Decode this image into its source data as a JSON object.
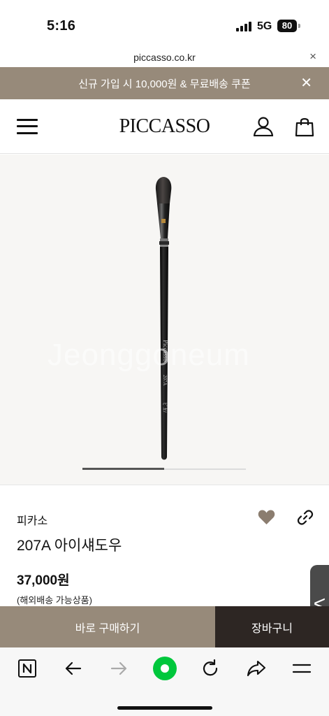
{
  "status": {
    "time": "5:16",
    "network": "5G",
    "battery": "80"
  },
  "browser": {
    "url": "piccasso.co.kr",
    "close": "×"
  },
  "promo": {
    "text": "신규 가입 시 10,000원 & 무료배송 쿠폰",
    "close": "✕"
  },
  "header": {
    "logo": "PICCASSO"
  },
  "gallery": {
    "watermark": "Jeonggoneum",
    "slide_index": 1,
    "slide_count": 2
  },
  "product": {
    "brand": "피카소",
    "name": "207A 아이섀도우",
    "price": "37,000원",
    "shipping": "(해외배송 가능상품)"
  },
  "actions": {
    "buy_label": "바로 구매하기",
    "cart_label": "장바구니"
  },
  "side_tab": {
    "label": "<"
  },
  "colors": {
    "accent": "#978a7a",
    "dark": "#2d2623",
    "navigator_green": "#00c73c"
  },
  "icons": [
    "hamburger-menu-icon",
    "user-icon",
    "shopping-bag-icon",
    "heart-icon",
    "link-icon",
    "naver-icon",
    "back-arrow-icon",
    "forward-arrow-icon",
    "green-dot-icon",
    "refresh-icon",
    "share-icon",
    "menu-lines-icon"
  ]
}
